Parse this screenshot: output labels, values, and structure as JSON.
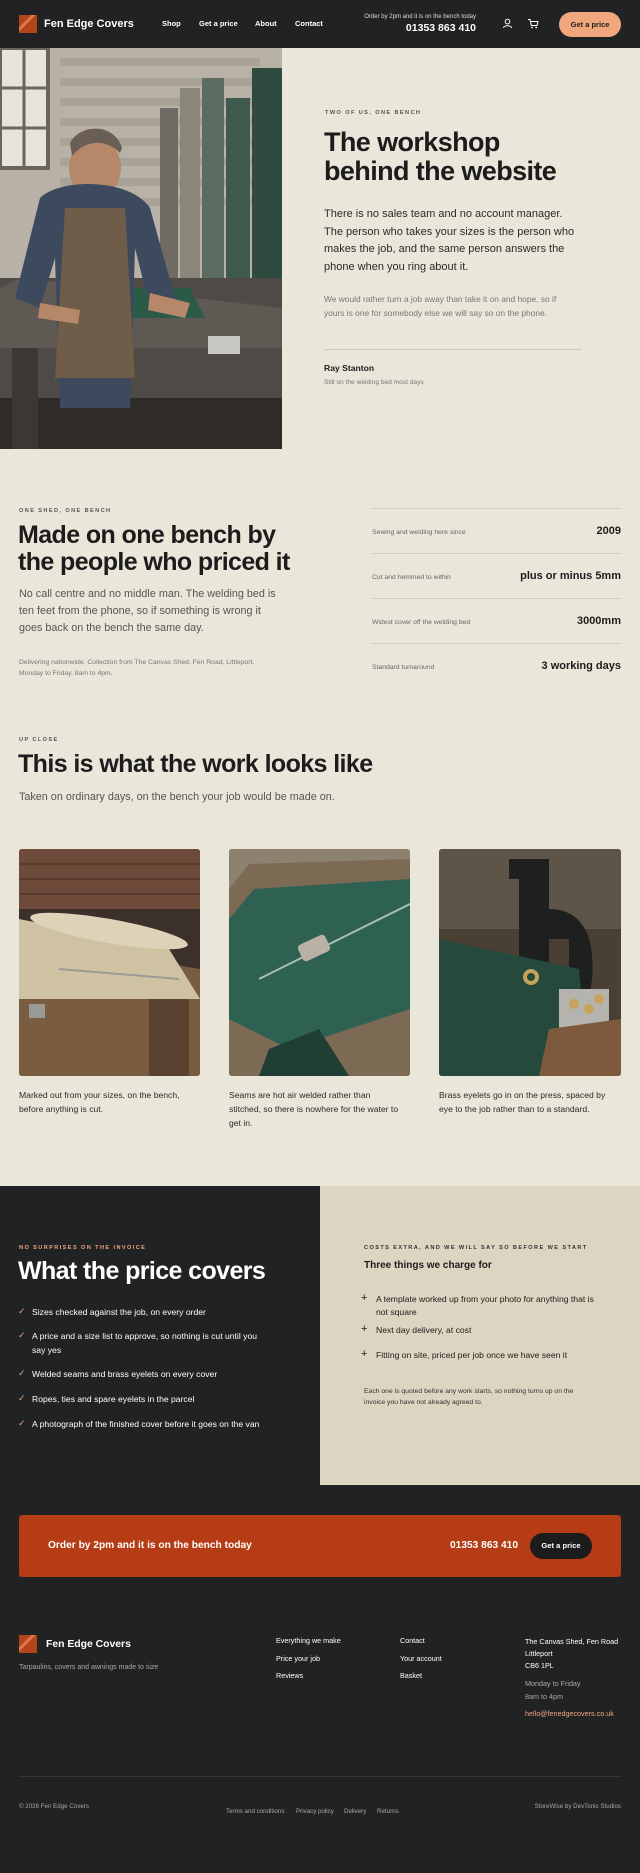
{
  "header": {
    "brand": "Fen Edge Covers",
    "nav": [
      "Shop",
      "Get a price",
      "About",
      "Contact"
    ],
    "order_note": "Order by 2pm and it is on the bench today",
    "phone": "01353 863 410",
    "cta": "Get a price",
    "icons": [
      "user-icon",
      "cart-icon"
    ]
  },
  "hero": {
    "eyebrow": "TWO OF US, ONE BENCH",
    "title_l1": "The workshop",
    "title_l2": "behind the website",
    "lead_l1": "There is no sales team and no account manager.",
    "lead_l2": "The person who takes your sizes is the person who",
    "lead_l3": "makes the job, and the same person answers the",
    "lead_l4": "phone when you ring about it.",
    "note_l1": "We would rather turn a job away than take it on and hope, so if",
    "note_l2": "yours is one for somebody else we will say so on the phone.",
    "name": "Ray Stanton",
    "role": "Still on the welding bed most days"
  },
  "bench": {
    "eyebrow": "ONE SHED, ONE BENCH",
    "title_l1": "Made on one bench by",
    "title_l2": "the people who priced it",
    "lead_l1": "No call centre and no middle man. The welding bed is",
    "lead_l2": "ten feet from the phone, so if something is wrong it",
    "lead_l3": "goes back on the bench the same day.",
    "note_l1": "Delivering nationwide. Collection from The Canvas Shed, Fen Road, Littleport,",
    "note_l2": "Monday to Friday, 8am to 4pm.",
    "stats": [
      {
        "label": "Sewing and welding here since",
        "value": "2009"
      },
      {
        "label": "Cut and hemmed to within",
        "value": "plus or minus 5mm"
      },
      {
        "label": "Widest cover off the welding bed",
        "value": "3000mm"
      },
      {
        "label": "Standard turnaround",
        "value": "3 working days"
      }
    ]
  },
  "upclose": {
    "eyebrow": "UP CLOSE",
    "title": "This is what the work looks like",
    "lead": "Taken on ordinary days, on the bench your job would be made on.",
    "captions": [
      [
        "Marked out from your sizes, on the bench,",
        "before anything is cut."
      ],
      [
        "Seams are hot air welded rather than",
        "stitched, so there is nowhere for the water to",
        "get in."
      ],
      [
        "Brass eyelets go in on the press, spaced by",
        "eye to the job rather than to a standard."
      ]
    ]
  },
  "price": {
    "eyebrow": "NO SURPRISES ON THE INVOICE",
    "title": "What the price covers",
    "items": [
      [
        "Sizes checked against the job, on every order"
      ],
      [
        "A price and a size list to approve, so nothing is cut until you",
        "say yes"
      ],
      [
        "Welded seams and brass eyelets on every cover"
      ],
      [
        "Ropes, ties and spare eyelets in the parcel"
      ],
      [
        "A photograph of the finished cover before it goes on the van"
      ]
    ],
    "extra_eyebrow": "COSTS EXTRA, AND WE WILL SAY SO BEFORE WE START",
    "extra_title": "Three things we charge for",
    "extras": [
      [
        "A template worked up from your photo for anything that is",
        "not square"
      ],
      [
        "Next day delivery, at cost"
      ],
      [
        "Fitting on site, priced per job once we have seen it"
      ]
    ],
    "extra_note_l1": "Each one is quoted before any work starts, so nothing turns up on the",
    "extra_note_l2": "invoice you have not already agreed to."
  },
  "banner": {
    "text": "Order by 2pm and it is on the bench today",
    "phone": "01353 863 410",
    "cta": "Get a price"
  },
  "footer": {
    "brand": "Fen Edge Covers",
    "tagline": "Tarpaulins, covers and awnings made to size",
    "col1": [
      "Everything we make",
      "Price your job",
      "Reviews"
    ],
    "col2": [
      "Contact",
      "Your account",
      "Basket"
    ],
    "address_l1": "The Canvas Shed, Fen Road",
    "address_l2": "Littleport",
    "address_l3": "CB6 1PL",
    "hours_l1": "Monday to Friday",
    "hours_l2": "8am to 4pm",
    "email": "hello@fenedgecovers.co.uk",
    "copyright": "© 2026 Fen Edge Covers",
    "legal": [
      "Terms and conditions",
      "Privacy policy",
      "Delivery",
      "Returns"
    ],
    "credit": "StoreWise by DevTonic Studios"
  },
  "colors": {
    "dark": "#212224",
    "cream": "#ebe6da",
    "sand": "#ddd4c1",
    "rust": "#b53c14",
    "peach": "#f0a77d"
  }
}
